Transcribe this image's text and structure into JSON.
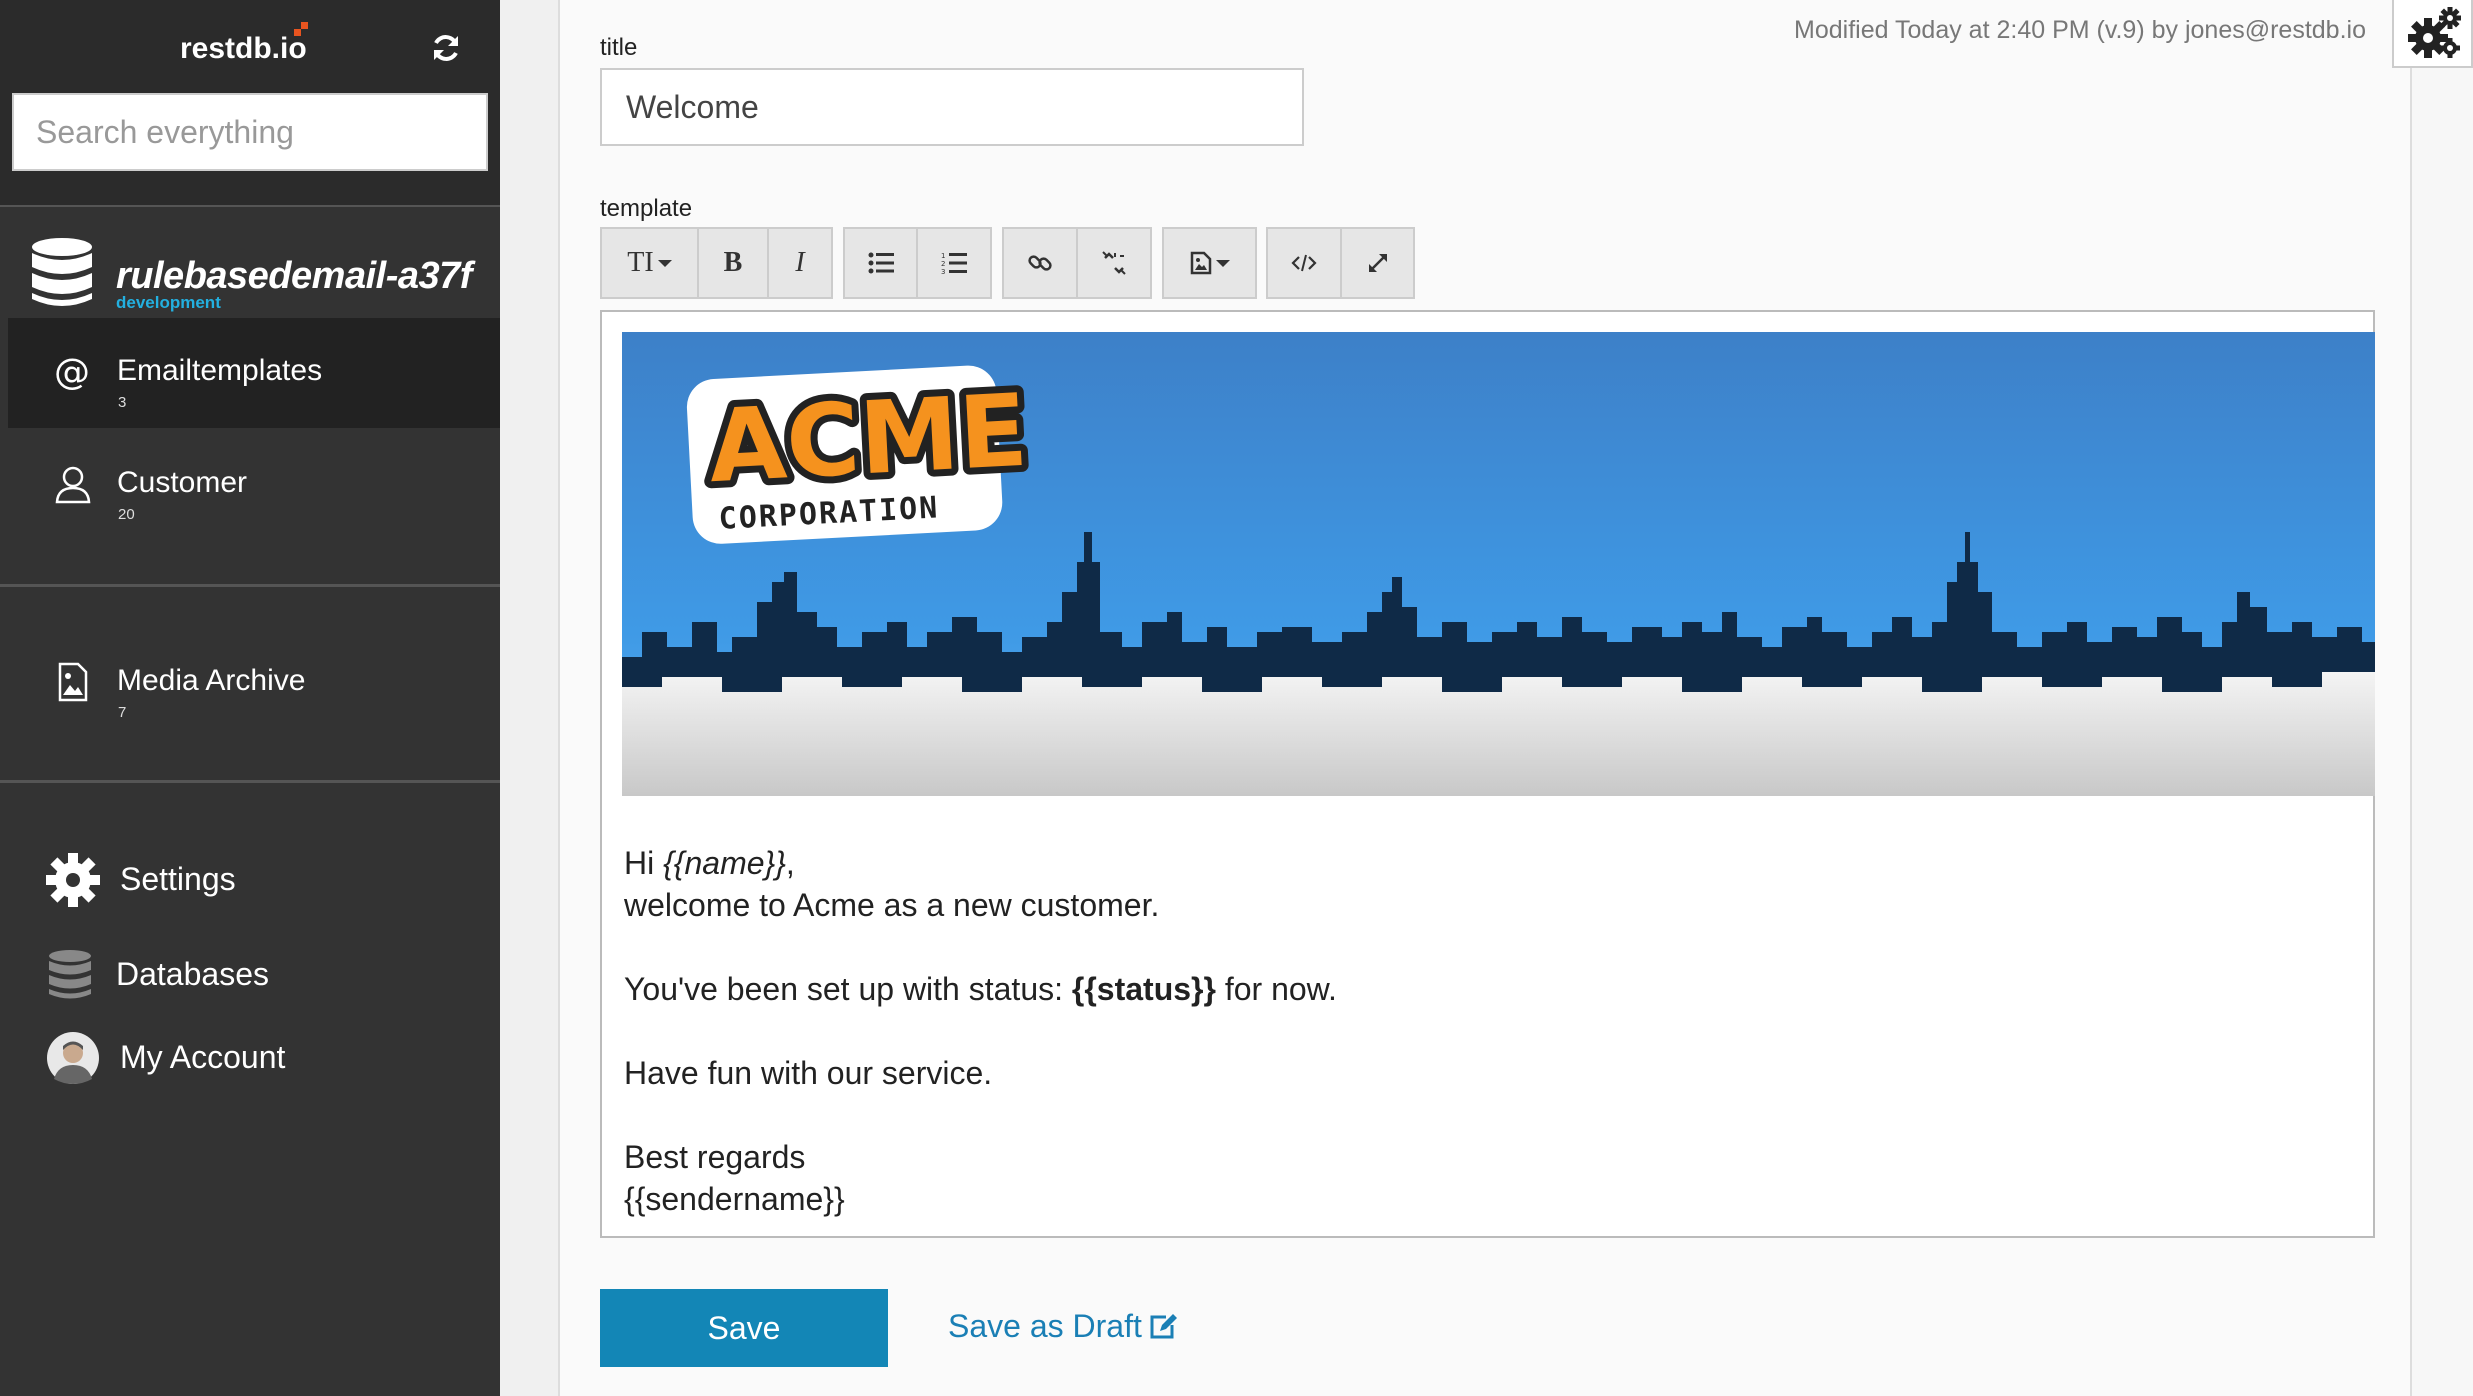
{
  "sidebar": {
    "brand": "restdb.io",
    "search_placeholder": "Search everything",
    "database": {
      "name": "rulebasedemail-a37f",
      "environment": "development"
    },
    "collections": [
      {
        "label": "Emailtemplates",
        "count": "3",
        "icon": "at-icon",
        "active": true
      },
      {
        "label": "Customer",
        "count": "20",
        "icon": "user-icon",
        "active": false
      },
      {
        "label": "Media Archive",
        "count": "7",
        "icon": "image-file-icon",
        "active": false
      }
    ],
    "bottom": [
      {
        "label": "Settings",
        "icon": "gear-icon"
      },
      {
        "label": "Databases",
        "icon": "database-icon"
      },
      {
        "label": "My Account",
        "icon": "avatar"
      }
    ]
  },
  "header": {
    "modified": "Modified Today at 2:40 PM (v.9) by jones@restdb.io"
  },
  "form": {
    "title_label": "title",
    "title_value": "Welcome",
    "template_label": "template"
  },
  "toolbar": {
    "font_size": "TI",
    "bold": "B",
    "italic": "I"
  },
  "banner": {
    "logo_main": "ACME",
    "logo_sub": "CORPORATION"
  },
  "email": {
    "greeting_prefix": "Hi ",
    "greeting_var": "{{name}}",
    "greeting_suffix": ",",
    "line2": "welcome to Acme as a new customer.",
    "status_prefix": "You've been set up with status: ",
    "status_var": "{{status}}",
    "status_suffix": " for now.",
    "line4": "Have fun with our service.",
    "closing": "Best regards",
    "sender": "{{sendername}}"
  },
  "actions": {
    "save": "Save",
    "draft": "Save as Draft"
  },
  "colors": {
    "sidebar_bg": "#333333",
    "accent": "#1386b6",
    "link": "#1a7fb5",
    "env_label": "#23b0e0",
    "brand_mark": "#e8541f"
  }
}
